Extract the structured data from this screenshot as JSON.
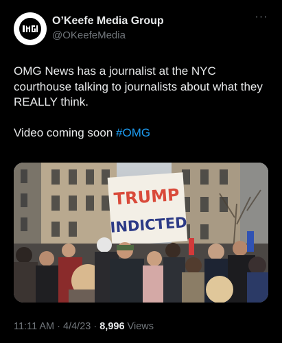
{
  "author": {
    "name": "O’Keefe Media Group",
    "handle": "@OKeefeMedia",
    "logo_icon": "omg-logo-icon"
  },
  "tweet": {
    "paragraph1": "OMG News has a journalist at the NYC courthouse talking to journalists about what they REALLY think.",
    "paragraph2_text": "Video coming soon ",
    "hashtag": "#OMG"
  },
  "media": {
    "sign_line1": "TRUMP",
    "sign_line2": "INDICTED"
  },
  "meta": {
    "time": "11:11 AM",
    "sep1": " · ",
    "date": "4/4/23",
    "sep2": " · ",
    "views_count": "8,996",
    "views_label": " Views"
  },
  "colors": {
    "background": "#000000",
    "text": "#e7e9ea",
    "secondary_text": "#71767b",
    "link": "#1d9bf0"
  }
}
